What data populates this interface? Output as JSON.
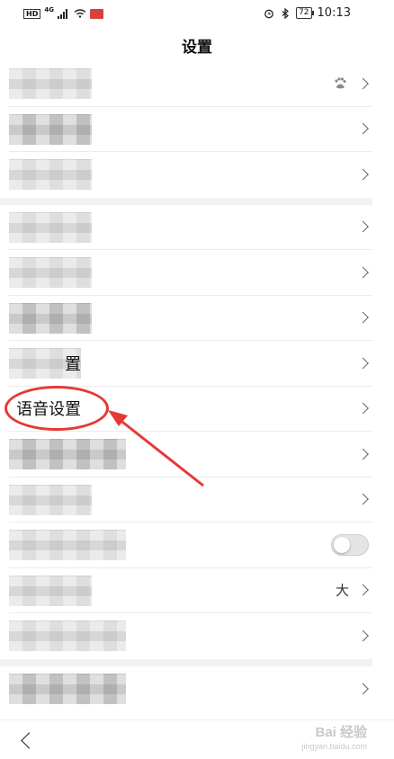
{
  "status_bar": {
    "network": "HD",
    "signal_type": "4G",
    "battery": "72",
    "time": "10:13"
  },
  "header": {
    "title": "设置"
  },
  "settings": {
    "group1": [
      {
        "id": "account",
        "label": "",
        "blurred": true,
        "icon": "baidu-paw-icon"
      },
      {
        "id": "item2",
        "label": "",
        "blurred": true
      },
      {
        "id": "item3",
        "label": "",
        "blurred": true
      }
    ],
    "group2": [
      {
        "id": "item4",
        "label": "",
        "blurred": true
      },
      {
        "id": "item5",
        "label": "",
        "blurred": true
      },
      {
        "id": "item6",
        "label": "",
        "blurred": true
      },
      {
        "id": "item7",
        "label": "置",
        "blurred": true
      },
      {
        "id": "voice",
        "label": "语音设置",
        "blurred": false
      },
      {
        "id": "item9",
        "label": "",
        "blurred": true
      },
      {
        "id": "item10",
        "label": "",
        "blurred": true
      },
      {
        "id": "item11",
        "label": "",
        "blurred": true,
        "toggle": "off"
      },
      {
        "id": "font",
        "label": "",
        "blurred": true,
        "value": "大"
      },
      {
        "id": "item13",
        "label": "",
        "blurred": true
      }
    ],
    "group3": [
      {
        "id": "item14",
        "label": "",
        "blurred": true
      }
    ]
  },
  "annotation": {
    "color": "#e53935",
    "target": "voice"
  },
  "watermark": {
    "text": "Bai  经验",
    "sub": "jingyan.baidu.com"
  }
}
